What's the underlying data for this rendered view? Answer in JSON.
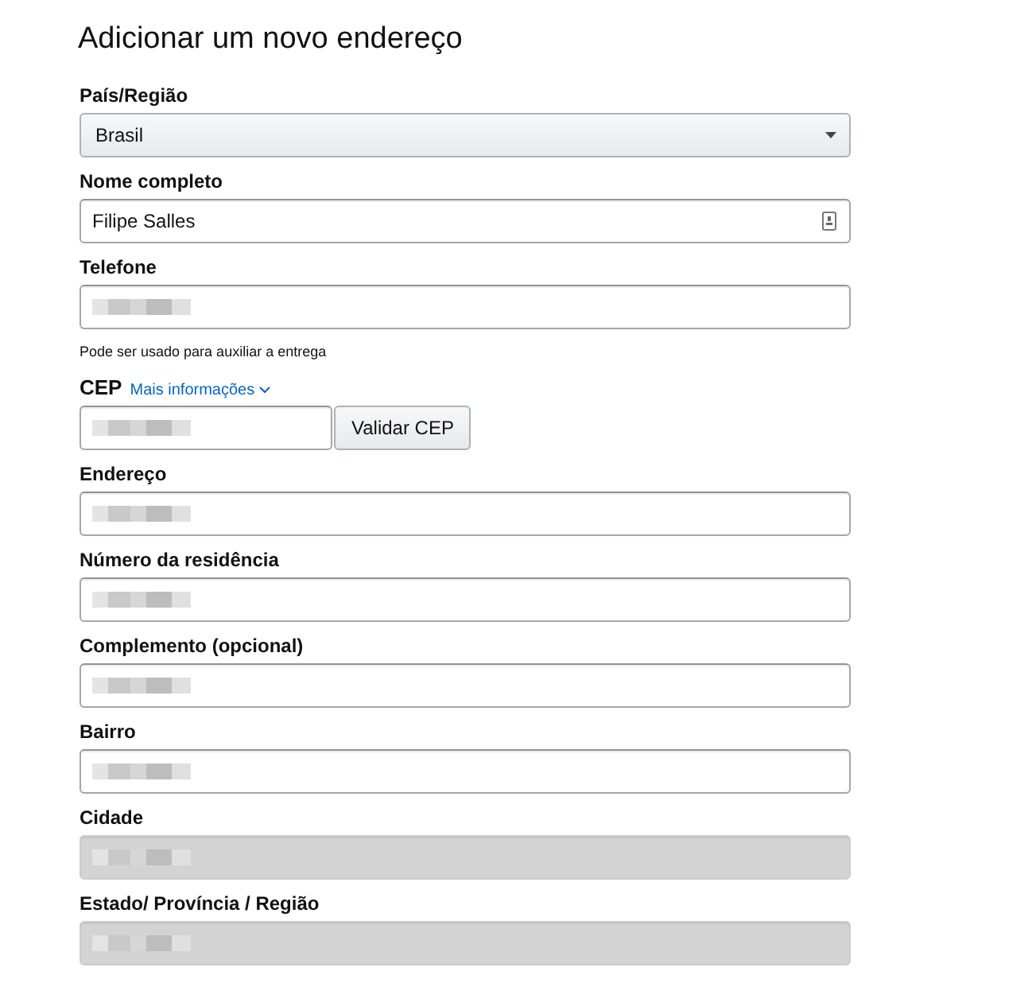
{
  "title": "Adicionar um novo endereço",
  "fields": [
    {
      "kind": "select",
      "label": "País/Região",
      "value": "Brasil"
    },
    {
      "kind": "text",
      "label": "Nome completo",
      "value": "Filipe Salles",
      "redacted": false,
      "disabled": false,
      "contact_icon": true
    },
    {
      "kind": "text",
      "label": "Telefone",
      "redacted": true,
      "disabled": false,
      "hint": "Pode ser usado para auxiliar a entrega"
    },
    {
      "kind": "postal",
      "label": "CEP",
      "link": "Mais informações",
      "button": "Validar CEP",
      "redacted": true,
      "disabled": false
    },
    {
      "kind": "text",
      "label": "Endereço",
      "redacted": true,
      "disabled": false
    },
    {
      "kind": "text",
      "label": "Número da residência",
      "redacted": true,
      "disabled": false
    },
    {
      "kind": "text",
      "label": "Complemento (opcional)",
      "redacted": true,
      "disabled": false
    },
    {
      "kind": "text",
      "label": "Bairro",
      "redacted": true,
      "disabled": false
    },
    {
      "kind": "text",
      "label": "Cidade",
      "redacted": true,
      "disabled": true
    },
    {
      "kind": "text",
      "label": "Estado/ Província / Região",
      "redacted": true,
      "disabled": true
    }
  ]
}
